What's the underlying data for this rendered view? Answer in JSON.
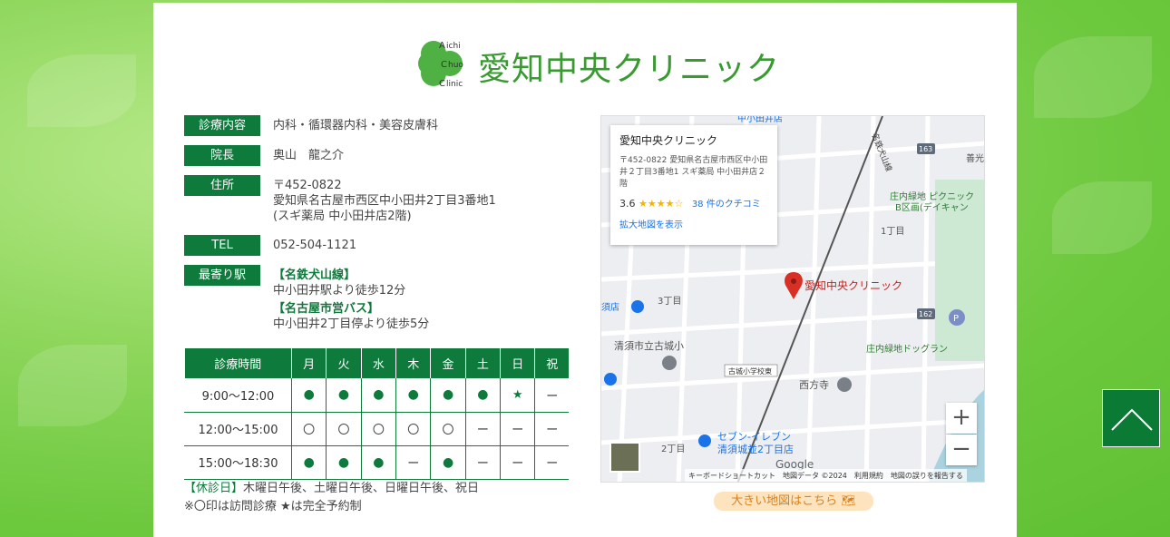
{
  "logo": {
    "mark_lines": [
      "A",
      "ichi",
      "C",
      "huo",
      "C",
      "linic"
    ],
    "name": "愛知中央クリニック"
  },
  "info": [
    {
      "label": "診療内容",
      "lines": [
        "内科・循環器内科・美容皮膚科"
      ]
    },
    {
      "label": "院長",
      "lines": [
        "奥山　龍之介"
      ]
    },
    {
      "label": "住所",
      "lines": [
        "〒452-0822",
        "愛知県名古屋市西区中小田井2丁目3番地1",
        "(スギ薬局 中小田井店2階)"
      ]
    },
    {
      "label": "TEL",
      "lines": [
        "052-504-1121"
      ]
    },
    {
      "label": "最寄り駅",
      "line_heading1": "【名鉄犬山線】",
      "line1": "中小田井駅より徒歩12分",
      "line_heading2": "【名古屋市営バス】",
      "line2": "中小田井2丁目停より徒歩5分"
    }
  ],
  "schedule": {
    "headers": [
      "診療時間",
      "月",
      "火",
      "水",
      "木",
      "金",
      "土",
      "日",
      "祝"
    ],
    "rows": [
      {
        "time": "9:00〜12:00",
        "cells": [
          "●",
          "●",
          "●",
          "●",
          "●",
          "●",
          "★",
          "ー"
        ]
      },
      {
        "time": "12:00〜15:00",
        "cells": [
          "〇",
          "〇",
          "〇",
          "〇",
          "〇",
          "ー",
          "ー",
          "ー"
        ]
      },
      {
        "time": "15:00〜18:30",
        "cells": [
          "●",
          "●",
          "●",
          "ー",
          "●",
          "ー",
          "ー",
          "ー"
        ]
      }
    ]
  },
  "notes": {
    "holiday_label": "【休診日】",
    "holiday_text": "木曜日午後、土曜日午後、日曜日午後、祝日",
    "legend": "※〇印は訪問診療 ★は完全予約制"
  },
  "map": {
    "card_title": "愛知中央クリニック",
    "card_address": "〒452-0822 愛知県名古屋市西区中小田井２丁目3番地1 スギ薬局 中小田井店２階",
    "rating": "3.6",
    "stars": "★★★★☆",
    "reviews": "38 件のクチコミ",
    "bigger_map": "拡大地図を表示",
    "marker_label": "愛知中央クリニック",
    "labels": [
      "3丁目",
      "2丁目",
      "1丁目",
      "西方寺",
      "清須市立古城小",
      "古城小学校東",
      "セブン-イレブン",
      "清須城並2丁目店",
      "庄内緑地 ピクニック",
      "B区画(デイキャン",
      "庄内緑地ドッグラン",
      "善光",
      "須店",
      "中小田井店",
      "名鉄犬山線",
      "163",
      "162"
    ],
    "zoom_in": "+",
    "zoom_out": "−",
    "attribution": "キーボードショートカット　地図データ ©2024　利用規約　地図の誤りを報告する",
    "google": "Google"
  },
  "big_map_button": "大きい地図はこちら 🗺",
  "colors": {
    "brand_green": "#0e7a3c",
    "logo_green": "#3a9a32",
    "bg_green": "#6cc83d"
  }
}
